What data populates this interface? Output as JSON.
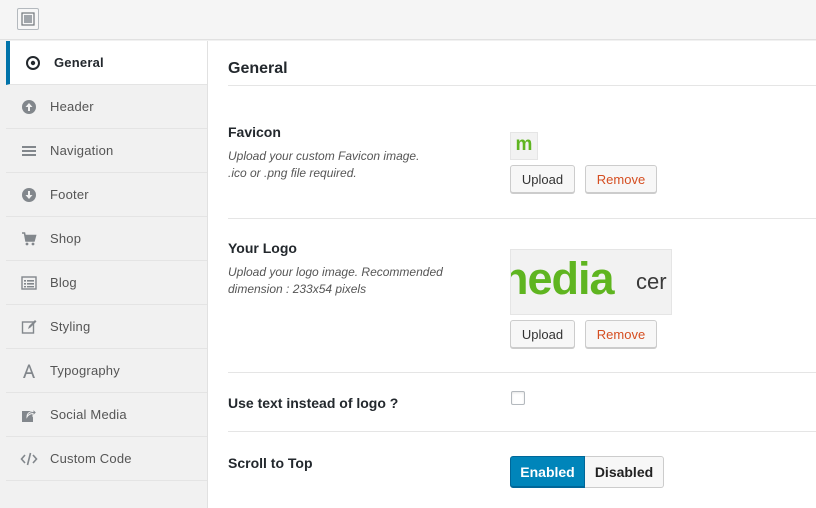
{
  "topbar": {
    "layout_icon": "layout-icon"
  },
  "sidebar": {
    "items": [
      {
        "label": "General",
        "icon": "target-icon",
        "active": true
      },
      {
        "label": "Header",
        "icon": "arrow-up-circle-icon"
      },
      {
        "label": "Navigation",
        "icon": "menu-icon"
      },
      {
        "label": "Footer",
        "icon": "arrow-down-circle-icon"
      },
      {
        "label": "Shop",
        "icon": "cart-icon"
      },
      {
        "label": "Blog",
        "icon": "list-view-icon"
      },
      {
        "label": "Styling",
        "icon": "edit-icon"
      },
      {
        "label": "Typography",
        "icon": "letter-a-icon"
      },
      {
        "label": "Social Media",
        "icon": "share-icon"
      },
      {
        "label": "Custom Code",
        "icon": "code-icon"
      }
    ]
  },
  "main": {
    "title": "General",
    "favicon": {
      "title": "Favicon",
      "desc_line1": "Upload your custom Favicon image.",
      "desc_line2": ".ico or .png file required.",
      "preview_letter": "m",
      "upload_label": "Upload",
      "remove_label": "Remove"
    },
    "logo": {
      "title": "Your Logo",
      "desc_line1": "Upload your logo image. Recommended",
      "desc_line2": "dimension : 233x54 pixels",
      "preview_text": "nedia",
      "preview_suffix": "cer",
      "upload_label": "Upload",
      "remove_label": "Remove"
    },
    "text_logo": {
      "title": "Use text instead of logo ?",
      "checked": false
    },
    "scroll_top": {
      "title": "Scroll to Top",
      "enabled_label": "Enabled",
      "disabled_label": "Disabled",
      "value": "Enabled"
    }
  },
  "colors": {
    "accent": "#0085ba",
    "logo_green": "#5fb520",
    "remove_red": "#d54e21"
  }
}
